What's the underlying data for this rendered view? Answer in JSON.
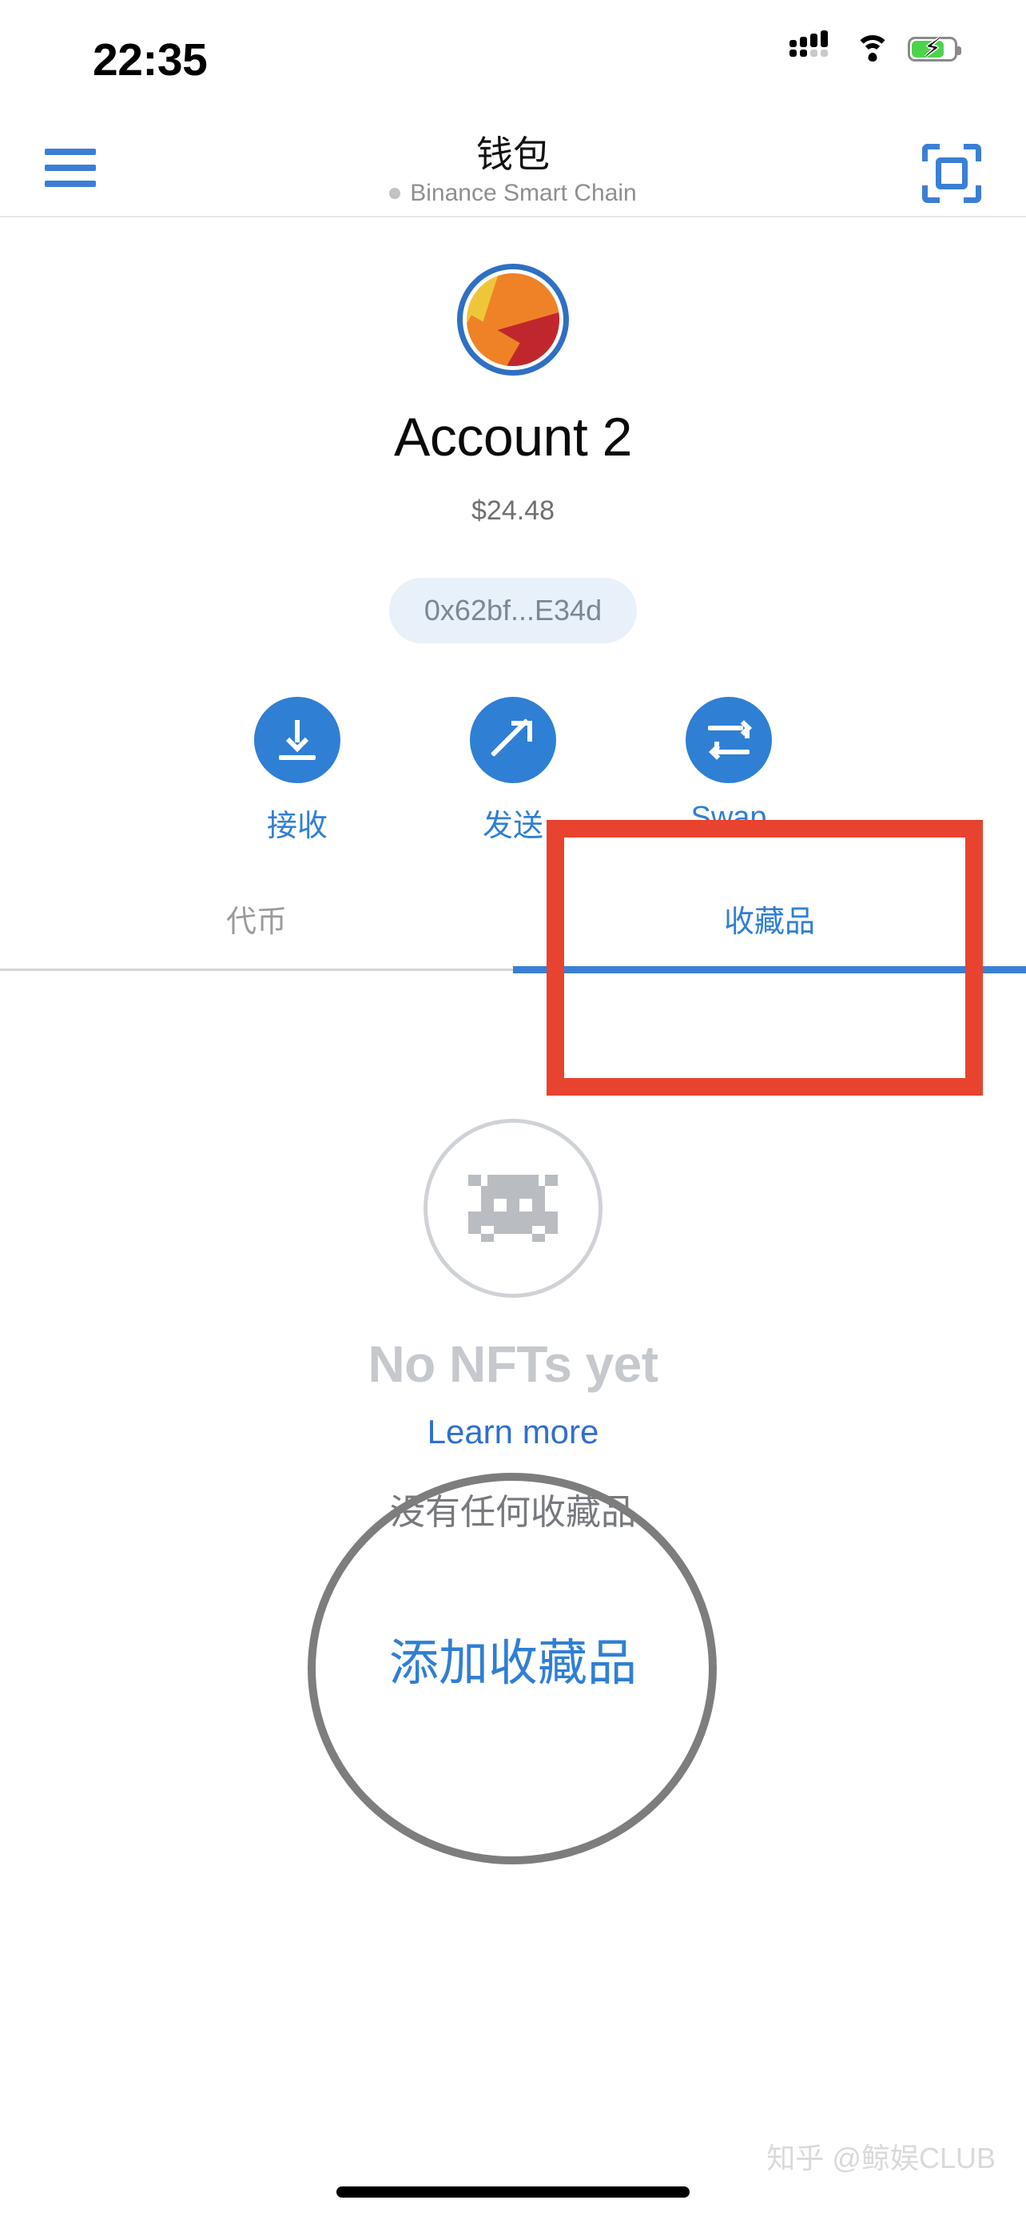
{
  "status_bar": {
    "time": "22:35",
    "signal_icon": "cellular-signal-icon",
    "wifi_icon": "wifi-icon",
    "battery_icon": "battery-charging-icon",
    "battery_color": "#4cd34c"
  },
  "header": {
    "menu_icon": "hamburger-menu-icon",
    "title": "钱包",
    "network": "Binance Smart Chain",
    "network_dot_color": "#c2c2c2",
    "scan_icon": "qr-scan-icon",
    "accent_color": "#3b7fd4"
  },
  "account": {
    "avatar_icon": "account-identicon",
    "name": "Account 2",
    "balance": "$24.48",
    "address": "0x62bf...E34d"
  },
  "actions": [
    {
      "icon": "download-arrow-icon",
      "label": "接收"
    },
    {
      "icon": "send-arrow-icon",
      "label": "发送"
    },
    {
      "icon": "swap-arrows-icon",
      "label": "Swap"
    }
  ],
  "tabs": [
    {
      "label": "代币",
      "active": false
    },
    {
      "label": "收藏品",
      "active": true
    }
  ],
  "empty_state": {
    "icon": "pixel-invader-icon",
    "title": "No NFTs yet",
    "learn_more": "Learn more",
    "no_collectibles": "没有任何收藏品",
    "add_collectible": "添加收藏品"
  },
  "annotations": {
    "rect_color": "#e8432f",
    "circle_color": "#7d7d7d"
  },
  "watermark": "知乎 @鲸娱CLUB"
}
